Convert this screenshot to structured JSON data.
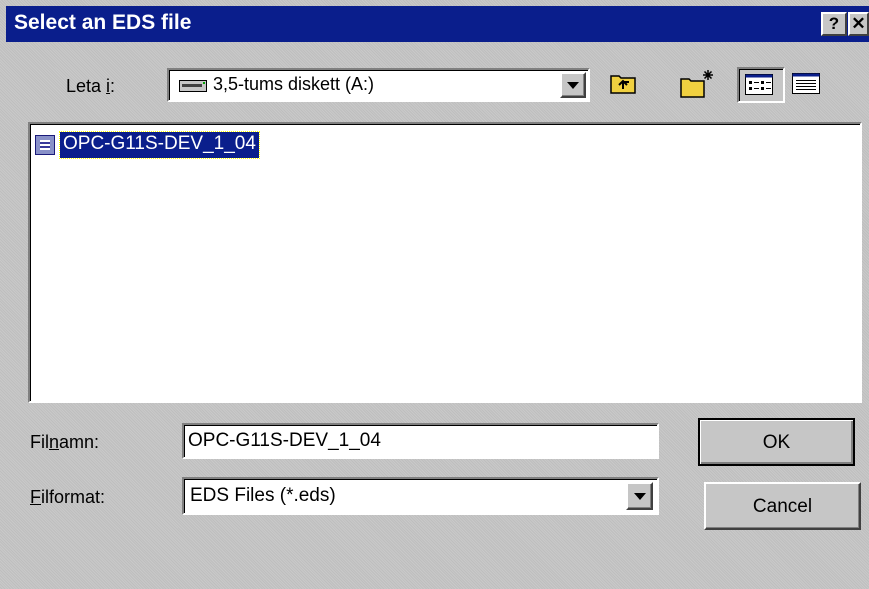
{
  "window": {
    "title": "Select an EDS file",
    "help_glyph": "?",
    "close_glyph": "✕"
  },
  "look_in": {
    "label_prefix": "Leta ",
    "label_mnemonic": "i",
    "label_suffix": ":",
    "value": "3,5-tums diskett (A:)",
    "drive_icon": "floppy-drive-icon"
  },
  "toolbar": {
    "up_icon": "up-one-level-icon",
    "new_folder_icon": "new-folder-icon",
    "list_view_icon": "list-view-icon",
    "details_view_icon": "details-view-icon"
  },
  "file_list": {
    "items": [
      {
        "name": "OPC-G11S-DEV_1_04",
        "icon": "eds-file-icon",
        "selected": true
      }
    ]
  },
  "filename": {
    "label_prefix": "Fil",
    "label_mnemonic": "n",
    "label_suffix": "amn:",
    "value": "OPC-G11S-DEV_1_04"
  },
  "filetype": {
    "label_mnemonic": "F",
    "label_suffix": "ilformat:",
    "value": "EDS Files (*.eds)"
  },
  "buttons": {
    "ok_label": "OK",
    "cancel_label": "Cancel"
  },
  "colors": {
    "titlebar": "#0a1e8c",
    "dialog_bg": "#c6c6c6",
    "selection": "#0a1e8c",
    "folder_yellow": "#f0d040"
  }
}
